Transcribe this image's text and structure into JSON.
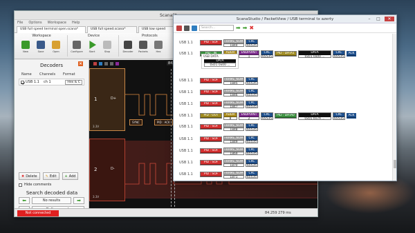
{
  "main": {
    "title": "ScanaSt",
    "menu": [
      "File",
      "Options",
      "Workspace",
      "Help"
    ],
    "tabs": [
      "USB full speed terminal open.scana*",
      "USB full speed.scana*",
      "USB low speed"
    ],
    "ribbon": {
      "workspace_group": "Workspace",
      "device_group": "Device",
      "protocols_group": "Protocols",
      "buttons": [
        "New",
        "Save",
        "Open",
        "Configure",
        "Start",
        "Stop",
        "Decoder",
        "Packets",
        "Hex"
      ]
    },
    "decoders": {
      "title": "Decoders",
      "headers": [
        "Name",
        "Channels",
        "Format"
      ],
      "row": {
        "name": "USB 1.1",
        "channels": "ch 1",
        "format": "Hex & C"
      },
      "delete_label": "Delete",
      "edit_label": "Edit",
      "add_label": "Add",
      "hide_comments_label": "Hide comments"
    },
    "search": {
      "title": "Search decoded data",
      "no_results": "No results",
      "define_label": "Define search"
    },
    "waveform": {
      "marker_label": "84260 µs",
      "ch1_number": "1",
      "ch1_label": "D+",
      "ch1_volt": "3.3V",
      "ch2_number": "2",
      "ch2_label": "D-",
      "ch2_volt": "3.3V",
      "bus_sync": "SYNC",
      "bus_pid": "PID : ACK"
    },
    "status": {
      "not_connected": "Not connected",
      "time": "84.259 279 ms"
    }
  },
  "packetview": {
    "title": "ScanaStudio / PacketView / USB terminal tx azerty",
    "search_placeholder": "Search...",
    "tooltip": {
      "title": "USB DATA",
      "field": "DATA",
      "value": "0x01 0x00 ..."
    },
    "rows": [
      {
        "label": "USB 1.1",
        "cells": [
          {
            "kind": "c-pid",
            "h": "PID : SOF"
          },
          {
            "kind": "c-frame",
            "h": "FRAME_NUM",
            "v": "1844"
          },
          {
            "kind": "c-crc",
            "h": "CRC",
            "v": "65535"
          }
        ]
      },
      {
        "label": "USB 1.1",
        "cells": [
          {
            "kind": "c-pid-g",
            "h": "PID : IN"
          },
          {
            "kind": "c-addr",
            "h": "ADDR",
            "v": "8"
          },
          {
            "kind": "c-ep",
            "h": "ENDPOINT",
            "v": "1"
          },
          {
            "kind": "c-crc",
            "h": "CRC",
            "v": "65535"
          },
          {
            "kind": "c-pid-y",
            "h": "PID : DATA1"
          },
          {
            "kind": "c-data",
            "h": "DATA",
            "v": "0x01 0x00 ..."
          },
          {
            "kind": "c-crc",
            "h": "CRC",
            "v": "65535"
          },
          {
            "kind": "c-ack",
            "h": "ACK"
          }
        ]
      },
      {
        "label": "USB 1.1",
        "cells": [
          {
            "kind": "c-pid",
            "h": "PID : SOF"
          },
          {
            "kind": "c-frame",
            "h": "FRAME_NUM",
            "v": "1845"
          },
          {
            "kind": "c-crc",
            "h": "CRC",
            "v": "65535"
          }
        ]
      },
      {
        "label": "USB 1.1",
        "cells": [
          {
            "kind": "c-pid",
            "h": "PID : SOF"
          },
          {
            "kind": "c-frame",
            "h": "FRAME_NUM",
            "v": "1846"
          },
          {
            "kind": "c-crc",
            "h": "CRC",
            "v": "65535"
          }
        ]
      },
      {
        "label": "USB 1.1",
        "cells": [
          {
            "kind": "c-pid",
            "h": "PID : SOF"
          },
          {
            "kind": "c-frame",
            "h": "FRAME_NUM",
            "v": "1847"
          },
          {
            "kind": "c-crc",
            "h": "CRC",
            "v": "65535"
          }
        ]
      },
      {
        "label": "USB 1.1",
        "cells": [
          {
            "kind": "c-pid-y",
            "h": "PID : OUT"
          },
          {
            "kind": "c-addr",
            "h": "ADDR",
            "v": "8"
          },
          {
            "kind": "c-ep",
            "h": "ENDPOINT",
            "v": "2"
          },
          {
            "kind": "c-crc",
            "h": "CRC",
            "v": "65535"
          },
          {
            "kind": "c-pid-g",
            "h": "PID : DATA0"
          },
          {
            "kind": "c-data",
            "h": "DATA",
            "v": "0x01 0x7A ..."
          },
          {
            "kind": "c-crc",
            "h": "CRC",
            "v": "65535"
          },
          {
            "kind": "c-ack",
            "h": "ACK"
          }
        ]
      },
      {
        "label": "USB 1.1",
        "cells": [
          {
            "kind": "c-pid",
            "h": "PID : SOF"
          },
          {
            "kind": "c-frame",
            "h": "FRAME_NUM",
            "v": "1848"
          },
          {
            "kind": "c-crc",
            "h": "CRC",
            "v": "65535"
          }
        ]
      },
      {
        "label": "USB 1.1",
        "cells": [
          {
            "kind": "c-pid",
            "h": "PID : SOF"
          },
          {
            "kind": "c-frame",
            "h": "FRAME_NUM",
            "v": "1849"
          },
          {
            "kind": "c-crc",
            "h": "CRC",
            "v": "65535"
          }
        ]
      },
      {
        "label": "USB 1.1",
        "cells": [
          {
            "kind": "c-pid",
            "h": "PID : SOF"
          },
          {
            "kind": "c-frame",
            "h": "FRAME_NUM",
            "v": "1869"
          },
          {
            "kind": "c-crc",
            "h": "CRC",
            "v": "65535"
          }
        ]
      },
      {
        "label": "USB 1.1",
        "cells": [
          {
            "kind": "c-pid",
            "h": "PID : SOF"
          },
          {
            "kind": "c-frame",
            "h": "FRAME_NUM",
            "v": "1870"
          },
          {
            "kind": "c-crc",
            "h": "CRC",
            "v": "65535"
          }
        ]
      },
      {
        "label": "USB 1.1",
        "cells": [
          {
            "kind": "c-pid",
            "h": "PID : SOF"
          },
          {
            "kind": "c-frame",
            "h": "FRAME_NUM",
            "v": "1871"
          },
          {
            "kind": "c-crc",
            "h": "CRC",
            "v": "65535"
          }
        ]
      },
      {
        "label": "USB 1.1",
        "cells": [
          {
            "kind": "c-pid",
            "h": "PID : SOF"
          },
          {
            "kind": "c-frame",
            "h": "FRAME_NUM",
            "v": "1872"
          },
          {
            "kind": "c-crc",
            "h": "CRC",
            "v": "65535"
          }
        ]
      },
      {
        "label": "USB 1.1",
        "cells": [
          {
            "kind": "c-pid",
            "h": "PID : SOF"
          },
          {
            "kind": "c-frame",
            "h": "FRAME_NUM",
            "v": "1873"
          },
          {
            "kind": "c-crc",
            "h": "CRC",
            "v": "65535"
          }
        ]
      }
    ]
  },
  "colors": {
    "accent_red": "#e02020",
    "pid_red": "#d32f2f",
    "crc_blue": "#1e4f8c",
    "pid_green": "#388e3c"
  }
}
